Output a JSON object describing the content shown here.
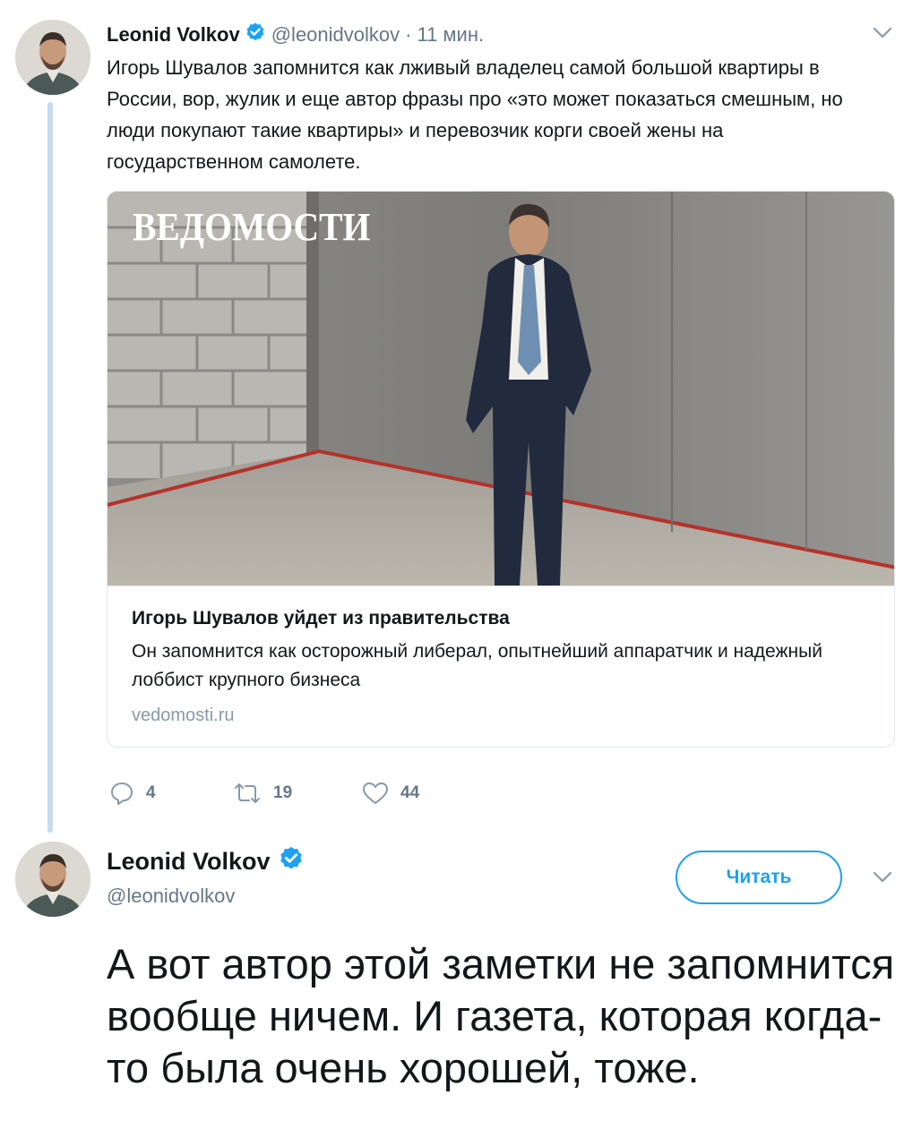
{
  "tweet1": {
    "author_name": "Leonid Volkov",
    "handle": "@leonidvolkov",
    "separator": "·",
    "time": "11 мин.",
    "verified_icon": "verified-badge-icon",
    "text": "Игорь Шувалов запомнится как лживый владелец самой большой квартиры в России, вор, жулик и еще автор фразы про «это может показаться смешным, но люди покупают такие квартиры» и перевозчик корги своей жены на государственном самолете.",
    "card": {
      "logo": "ВЕДОМОСТИ",
      "title": "Игорь Шувалов уйдет из правительства",
      "description": "Он запомнится как осторожный либерал, опытнейший аппаратчик и надежный лоббист крупного бизнеса",
      "domain": "vedomosti.ru"
    },
    "actions": {
      "replies": "4",
      "retweets": "19",
      "likes": "44"
    }
  },
  "tweet2": {
    "author_name": "Leonid Volkov",
    "handle": "@leonidvolkov",
    "follow_label": "Читать",
    "text": "А вот автор этой заметки не запомнится вообще ничем. И газета, которая когда-то была очень хорошей, тоже."
  },
  "colors": {
    "accent": "#1da1f2",
    "thread_line": "#c4dcef",
    "secondary_text": "#657786"
  }
}
